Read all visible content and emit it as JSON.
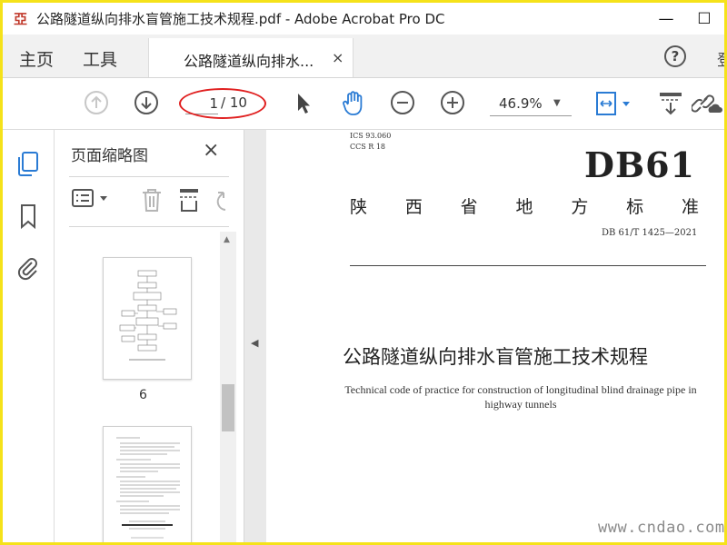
{
  "window": {
    "app_icon_text": "亞",
    "title": "公路隧道纵向排水盲管施工技术规程.pdf - Adobe Acrobat Pro DC",
    "minimize": "—",
    "maximize": "☐"
  },
  "nav": {
    "home": "主页",
    "tools": "工具",
    "doc_tab_label": "公路隧道纵向排水...",
    "doc_tab_close": "×",
    "help": "?",
    "signin": "登"
  },
  "toolbar": {
    "page_current": "1",
    "page_total": "/ 10",
    "zoom": "46.9%"
  },
  "thumbnails": {
    "title": "页面缩略图",
    "close": "×",
    "pages": [
      {
        "label": "6"
      },
      {
        "label": ""
      }
    ]
  },
  "document": {
    "ics": "ICS 93.060",
    "ccs": "CCS R 18",
    "code": "DB61",
    "province": [
      "陕",
      "西",
      "省",
      "地",
      "方",
      "标",
      "准"
    ],
    "standard_no": "DB 61/T 1425—2021",
    "title_cn": "公路隧道纵向排水盲管施工技术规程",
    "title_en": "Technical code of practice for construction of longitudinal blind drainage pipe in highway tunnels"
  },
  "watermark": "www.cndao.com",
  "colors": {
    "frame_border": "#f5e21a",
    "hand_tool_blue": "#2a7bd4",
    "annotation_red": "#e02020",
    "rail_active_blue": "#2a7bd4"
  }
}
